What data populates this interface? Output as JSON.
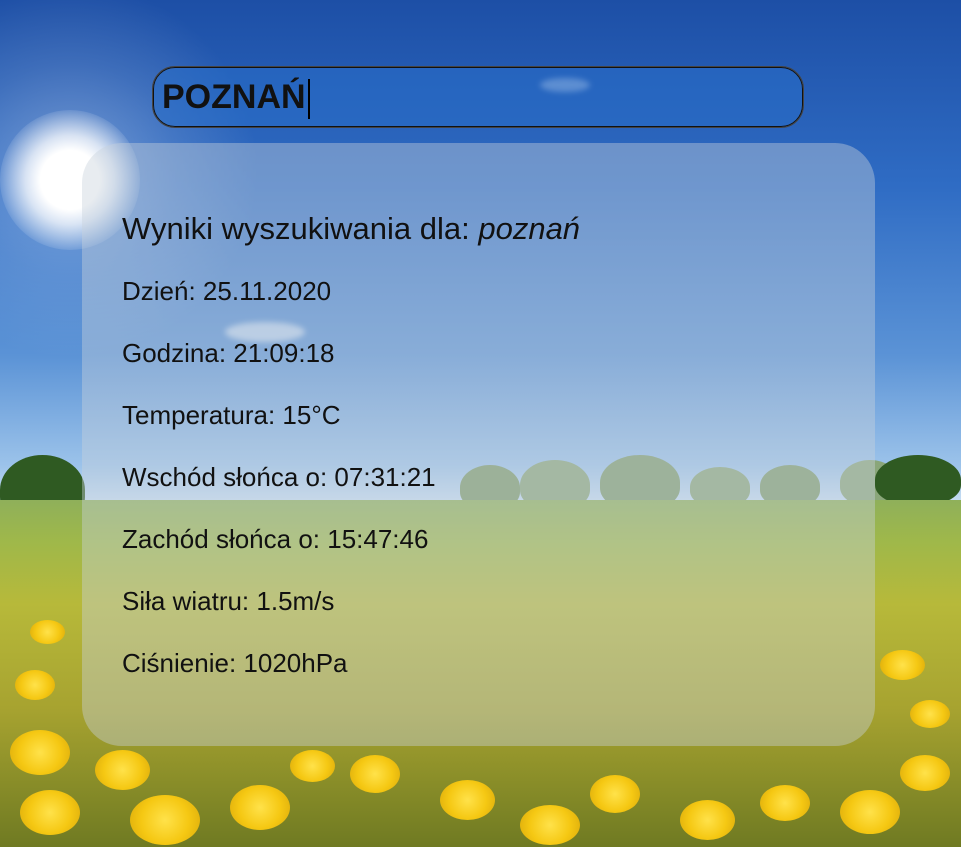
{
  "search": {
    "value": "POZNAŃ"
  },
  "results": {
    "heading_prefix": "Wyniki wyszukiwania dla: ",
    "query": "poznań",
    "rows": [
      "Dzień: 25.11.2020",
      "Godzina: 21:09:18",
      "Temperatura: 15°C",
      "Wschód słońca o: 07:31:21",
      "Zachód słońca o: 15:47:46",
      "Siła wiatru: 1.5m/s",
      "Ciśnienie: 1020hPa"
    ]
  }
}
